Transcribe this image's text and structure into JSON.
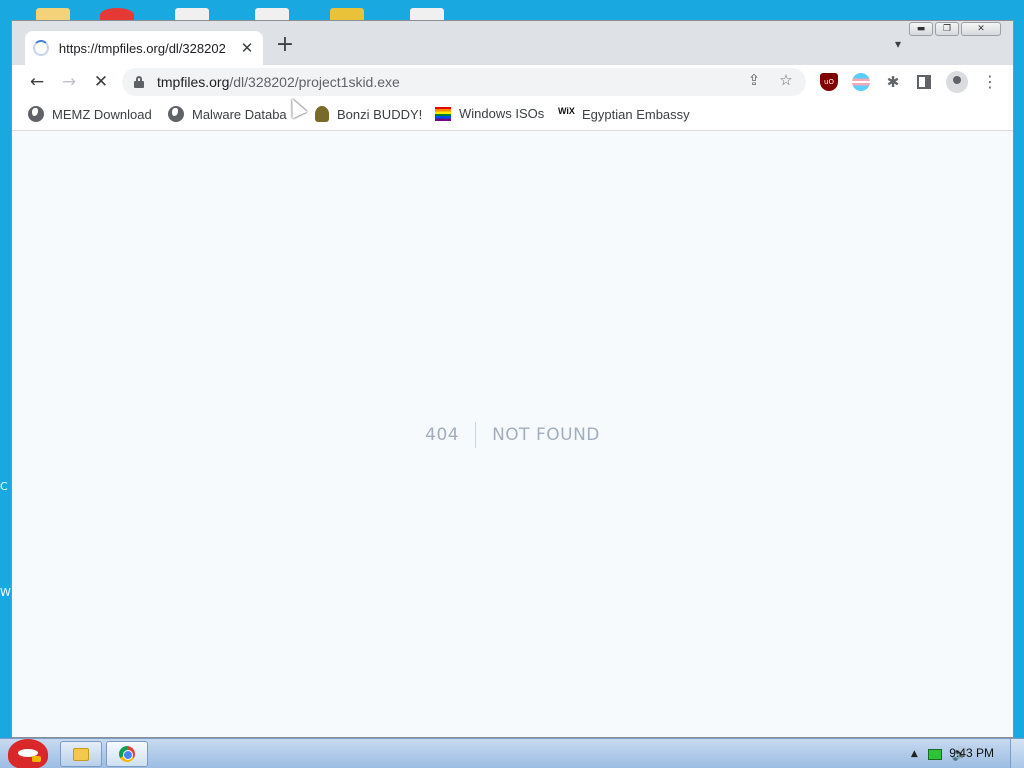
{
  "browser": {
    "tab": {
      "title": "https://tmpfiles.org/dl/328202"
    },
    "address_bar": {
      "host": "tmpfiles.org",
      "path": "/dl/328202/project1skid.exe"
    },
    "bookmarks": [
      {
        "label": "MEMZ Download",
        "icon": "globe-icon"
      },
      {
        "label": "Malware Databa",
        "icon": "globe-icon"
      },
      {
        "label": "Bonzi BUDDY!",
        "icon": "bonzi-icon"
      },
      {
        "label": "Windows ISOs",
        "icon": "rainbow-flag-icon"
      },
      {
        "label": "Egyptian Embassy",
        "icon": "wix-icon",
        "icon_text": "WiX"
      }
    ],
    "extensions": [
      "ublock-origin-icon",
      "trans-flag-extension-icon",
      "extensions-puzzle-icon",
      "side-panel-icon",
      "profile-avatar-icon"
    ]
  },
  "page": {
    "error_code": "404",
    "error_message": "NOT FOUND"
  },
  "taskbar": {
    "clock": "9:43 PM",
    "pinned": [
      "file-explorer-icon",
      "chrome-icon"
    ]
  },
  "desktop": {
    "left_edge_chars": [
      "C",
      "W"
    ]
  },
  "colors": {
    "desktop": "#19a8e0",
    "page_bg": "#f7fafc",
    "error_text": "#a0aec0"
  }
}
